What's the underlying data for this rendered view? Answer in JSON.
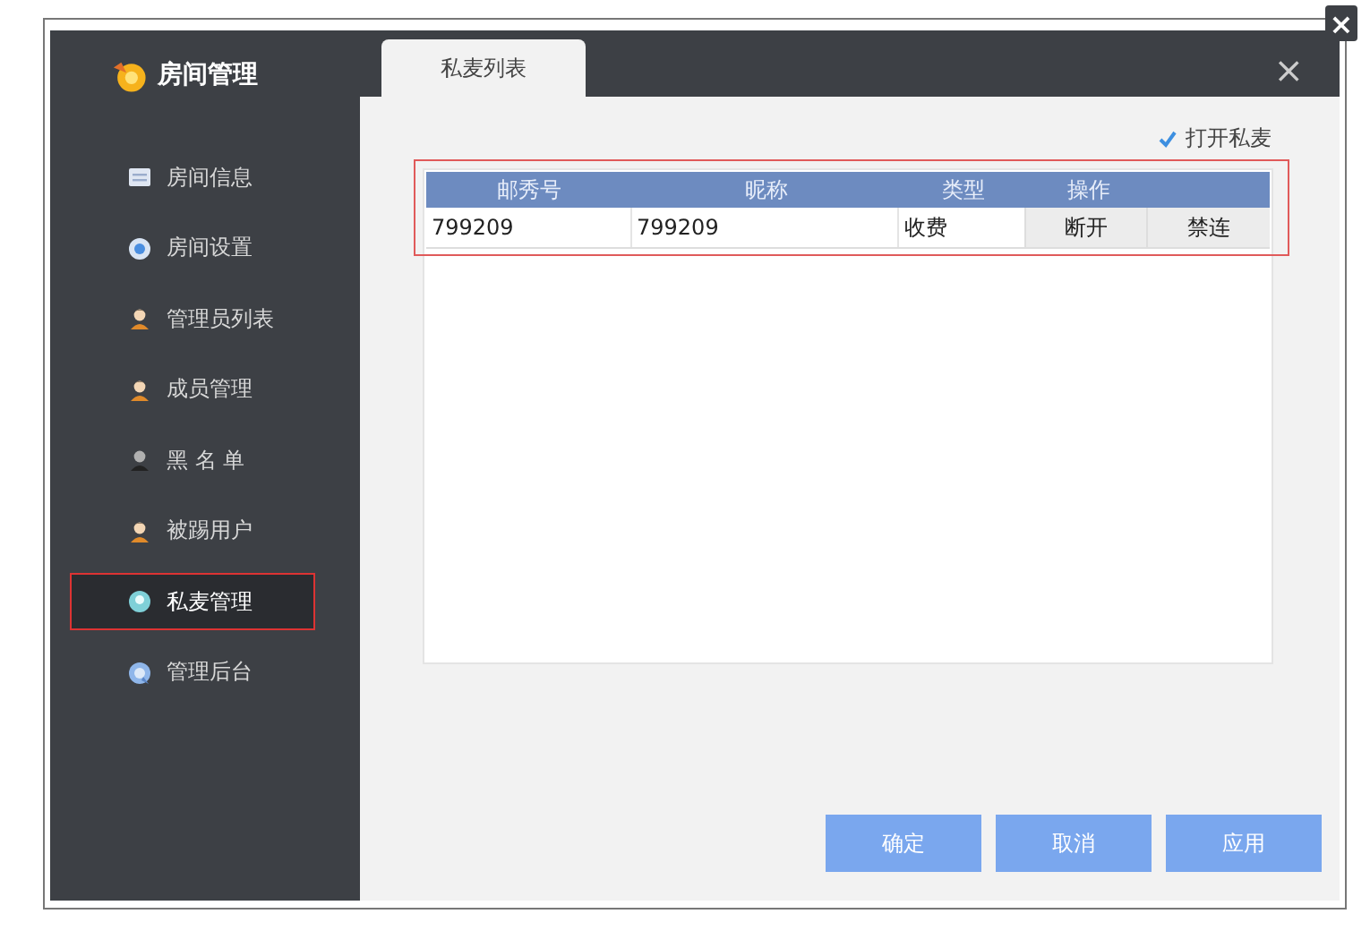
{
  "window": {
    "title": "房间管理",
    "close": "×",
    "outer_close": "×"
  },
  "sidebar": {
    "items": [
      {
        "label": "房间信息",
        "selected": false
      },
      {
        "label": "房间设置",
        "selected": false
      },
      {
        "label": "管理员列表",
        "selected": false
      },
      {
        "label": "成员管理",
        "selected": false
      },
      {
        "label": "黑 名 单",
        "selected": false
      },
      {
        "label": "被踢用户",
        "selected": false
      },
      {
        "label": "私麦管理",
        "selected": true,
        "highlighted": true
      },
      {
        "label": "管理后台",
        "selected": false
      }
    ]
  },
  "tabs": [
    {
      "label": "私麦列表",
      "selected": true
    }
  ],
  "option": {
    "label": "打开私麦",
    "checked": true
  },
  "table": {
    "highlighted": true,
    "columns": [
      "邮秀号",
      "昵称",
      "类型",
      "操作"
    ],
    "rows": [
      {
        "cells": [
          "799209",
          "799209",
          "收费"
        ],
        "actions": [
          "断开",
          "禁连"
        ]
      }
    ]
  },
  "buttons": [
    "确定",
    "取消",
    "应用"
  ]
}
